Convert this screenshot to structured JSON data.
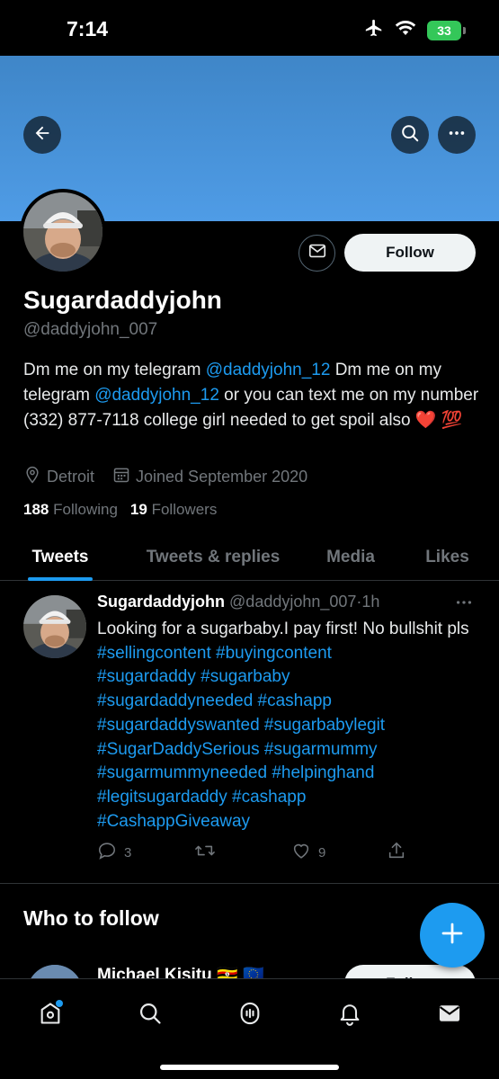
{
  "status_bar": {
    "time": "7:14",
    "battery": "33"
  },
  "profile": {
    "display_name": "Sugardaddyjohn",
    "handle": "@daddyjohn_007",
    "bio": {
      "p1": "Dm me on my telegram ",
      "mention1": "@daddyjohn_12",
      "p2": " Dm me on my telegram ",
      "mention2": "@daddyjohn_12",
      "p3": " or you can text me on my number (332) 877-7118 college girl needed to get spoil also ❤️ 💯"
    },
    "location": "Detroit",
    "joined": "Joined September 2020",
    "following_count": "188",
    "following_label": "Following",
    "followers_count": "19",
    "followers_label": "Followers",
    "follow_label": "Follow"
  },
  "tabs": [
    {
      "label": "Tweets",
      "active": true
    },
    {
      "label": "Tweets & replies",
      "active": false
    },
    {
      "label": "Media",
      "active": false
    },
    {
      "label": "Likes",
      "active": false
    }
  ],
  "tweet": {
    "name": "Sugardaddyjohn",
    "handle": "@daddyjohn_007",
    "time": "1h",
    "text_plain": "Looking for a sugarbaby.I pay first! No bullshit pls ",
    "hashtags": {
      "t1": "#sellingcontent",
      "t2": "#buyingcontent",
      "t3": "#sugardaddy",
      "t4": "#sugarbaby",
      "t5": "#sugardaddyneeded",
      "t6": "#cashapp",
      "t7": "#sugardaddyswanted",
      "t8": "#sugarbabylegit",
      "t9": "#SugarDaddySerious",
      "t10": "#sugarmummy",
      "t11": "#sugarmummyneeded",
      "t12": "#helpinghand",
      "t13": "#legitsugardaddy",
      "t14": "#cashapp",
      "t15": "#CashappGiveaway"
    },
    "replies": "3",
    "likes": "9"
  },
  "who_to_follow": {
    "title": "Who to follow",
    "suggestion_name": "Michael Kisitu 🇺🇬 🇪🇺",
    "follow_label": "Follow"
  },
  "colors": {
    "accent": "#1d9bf0",
    "banner": "#4f9ce6",
    "text": "#e7e9ea",
    "muted": "#71767b",
    "battery": "#34c759"
  },
  "icons": [
    "airplane-icon",
    "wifi-icon",
    "battery-icon",
    "back-arrow-icon",
    "search-icon",
    "more-icon",
    "mail-icon",
    "location-pin-icon",
    "calendar-icon",
    "reply-icon",
    "retweet-icon",
    "like-icon",
    "share-icon",
    "plus-icon",
    "home-icon",
    "explore-icon",
    "spaces-icon",
    "bell-icon",
    "messages-icon"
  ]
}
